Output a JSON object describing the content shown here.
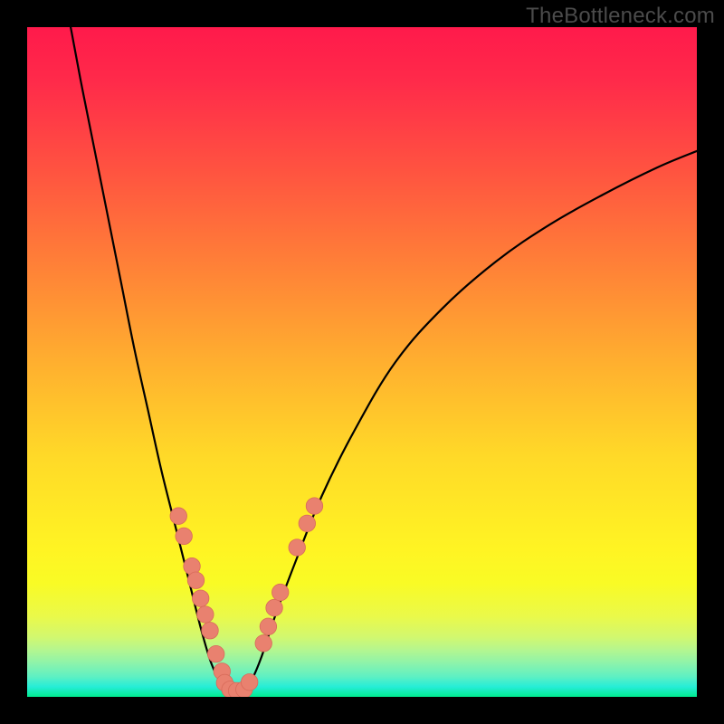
{
  "watermark": "TheBottleneck.com",
  "colors": {
    "curve": "#000000",
    "marker_fill": "#e9816f",
    "marker_stroke": "#d86b5a",
    "frame": "#000000"
  },
  "chart_data": {
    "type": "line",
    "title": "",
    "xlabel": "",
    "ylabel": "",
    "xlim": [
      0,
      100
    ],
    "ylim": [
      0,
      100
    ],
    "grid": false,
    "annotations": [
      "TheBottleneck.com"
    ],
    "note": "Axis values are normalized 0-100 estimates read from pixel positions; no tick labels are present in the source image.",
    "curves": [
      {
        "name": "left-branch",
        "points": [
          {
            "x": 6.5,
            "y": 100
          },
          {
            "x": 8,
            "y": 92
          },
          {
            "x": 10,
            "y": 82
          },
          {
            "x": 12,
            "y": 72
          },
          {
            "x": 14,
            "y": 62
          },
          {
            "x": 16,
            "y": 52
          },
          {
            "x": 18,
            "y": 43
          },
          {
            "x": 20,
            "y": 34
          },
          {
            "x": 22,
            "y": 26
          },
          {
            "x": 24,
            "y": 18
          },
          {
            "x": 26,
            "y": 10
          },
          {
            "x": 27.5,
            "y": 5
          },
          {
            "x": 29,
            "y": 2
          },
          {
            "x": 30.5,
            "y": 0.8
          }
        ]
      },
      {
        "name": "right-branch",
        "points": [
          {
            "x": 32,
            "y": 0.8
          },
          {
            "x": 33.5,
            "y": 2.5
          },
          {
            "x": 35,
            "y": 6
          },
          {
            "x": 37,
            "y": 12
          },
          {
            "x": 40,
            "y": 20
          },
          {
            "x": 44,
            "y": 30
          },
          {
            "x": 49,
            "y": 40
          },
          {
            "x": 55,
            "y": 50
          },
          {
            "x": 62,
            "y": 58
          },
          {
            "x": 70,
            "y": 65
          },
          {
            "x": 78,
            "y": 70.5
          },
          {
            "x": 86,
            "y": 75
          },
          {
            "x": 94,
            "y": 79
          },
          {
            "x": 100,
            "y": 81.5
          }
        ]
      }
    ],
    "markers": [
      {
        "x": 22.6,
        "y": 27.0,
        "r": 1.25
      },
      {
        "x": 23.4,
        "y": 24.0,
        "r": 1.25
      },
      {
        "x": 24.6,
        "y": 19.5,
        "r": 1.25
      },
      {
        "x": 25.2,
        "y": 17.4,
        "r": 1.25
      },
      {
        "x": 25.9,
        "y": 14.7,
        "r": 1.25
      },
      {
        "x": 26.6,
        "y": 12.3,
        "r": 1.25
      },
      {
        "x": 27.3,
        "y": 9.9,
        "r": 1.25
      },
      {
        "x": 28.2,
        "y": 6.4,
        "r": 1.25
      },
      {
        "x": 29.1,
        "y": 3.8,
        "r": 1.25
      },
      {
        "x": 29.5,
        "y": 2.1,
        "r": 1.25
      },
      {
        "x": 30.3,
        "y": 1.1,
        "r": 1.25
      },
      {
        "x": 31.3,
        "y": 0.9,
        "r": 1.25
      },
      {
        "x": 32.4,
        "y": 1.1,
        "r": 1.25
      },
      {
        "x": 33.2,
        "y": 2.2,
        "r": 1.25
      },
      {
        "x": 35.3,
        "y": 8.0,
        "r": 1.25
      },
      {
        "x": 36.0,
        "y": 10.5,
        "r": 1.25
      },
      {
        "x": 36.9,
        "y": 13.3,
        "r": 1.25
      },
      {
        "x": 37.8,
        "y": 15.6,
        "r": 1.25
      },
      {
        "x": 40.3,
        "y": 22.3,
        "r": 1.25
      },
      {
        "x": 41.8,
        "y": 25.9,
        "r": 1.25
      },
      {
        "x": 42.9,
        "y": 28.5,
        "r": 1.25
      }
    ]
  }
}
